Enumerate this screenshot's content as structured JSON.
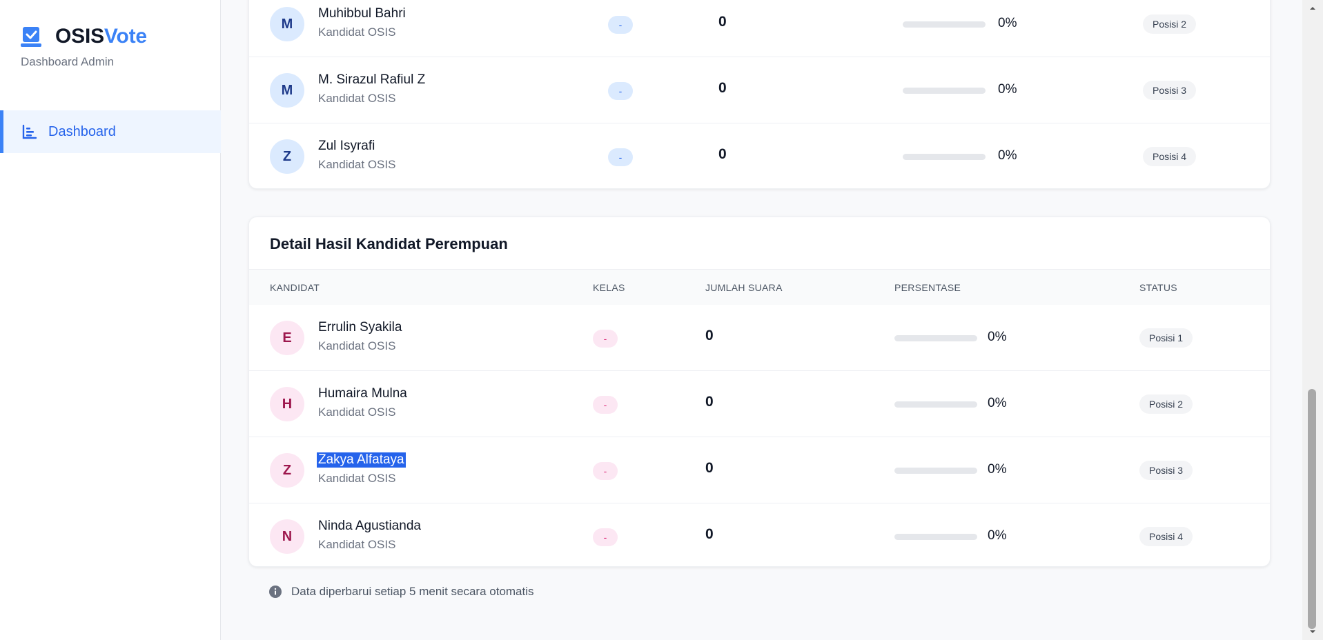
{
  "sidebar": {
    "brand_part1": "OSIS",
    "brand_part2": "Vote",
    "subtitle": "Dashboard Admin",
    "nav_dashboard": "Dashboard"
  },
  "male_rows": [
    {
      "initial": "M",
      "name": "Muhibbul Bahri",
      "role": "Kandidat OSIS",
      "kelas": "-",
      "votes": "0",
      "percent": "0%",
      "progress": 0,
      "status": "Posisi 2"
    },
    {
      "initial": "M",
      "name": "M. Sirazul Rafiul Z",
      "role": "Kandidat OSIS",
      "kelas": "-",
      "votes": "0",
      "percent": "0%",
      "progress": 0,
      "status": "Posisi 3"
    },
    {
      "initial": "Z",
      "name": "Zul Isyrafi",
      "role": "Kandidat OSIS",
      "kelas": "-",
      "votes": "0",
      "percent": "0%",
      "progress": 0,
      "status": "Posisi 4"
    }
  ],
  "female": {
    "title": "Detail Hasil Kandidat Perempuan",
    "headers": {
      "kandidat": "KANDIDAT",
      "kelas": "KELAS",
      "jumlah_suara": "JUMLAH SUARA",
      "persentase": "PERSENTASE",
      "status": "STATUS"
    },
    "rows": [
      {
        "initial": "E",
        "name": "Errulin Syakila",
        "role": "Kandidat OSIS",
        "kelas": "-",
        "votes": "0",
        "percent": "0%",
        "progress": 0,
        "status": "Posisi 1"
      },
      {
        "initial": "H",
        "name": "Humaira Mulna",
        "role": "Kandidat OSIS",
        "kelas": "-",
        "votes": "0",
        "percent": "0%",
        "progress": 0,
        "status": "Posisi 2"
      },
      {
        "initial": "Z",
        "name": "Zakya Alfataya",
        "role": "Kandidat OSIS",
        "kelas": "-",
        "votes": "0",
        "percent": "0%",
        "progress": 0,
        "status": "Posisi 3"
      },
      {
        "initial": "N",
        "name": "Ninda Agustianda",
        "role": "Kandidat OSIS",
        "kelas": "-",
        "votes": "0",
        "percent": "0%",
        "progress": 0,
        "status": "Posisi 4"
      }
    ]
  },
  "footer_note": "Data diperbarui setiap 5 menit secara otomatis",
  "icons": {
    "brand": "check-square-icon",
    "dashboard": "chart-bar-icon",
    "info": "info-circle-icon"
  },
  "colors": {
    "accent": "#3b82f6",
    "male_avatar_bg": "#dbeafe",
    "female_avatar_bg": "#fce7f3",
    "selection": "#2563eb"
  }
}
